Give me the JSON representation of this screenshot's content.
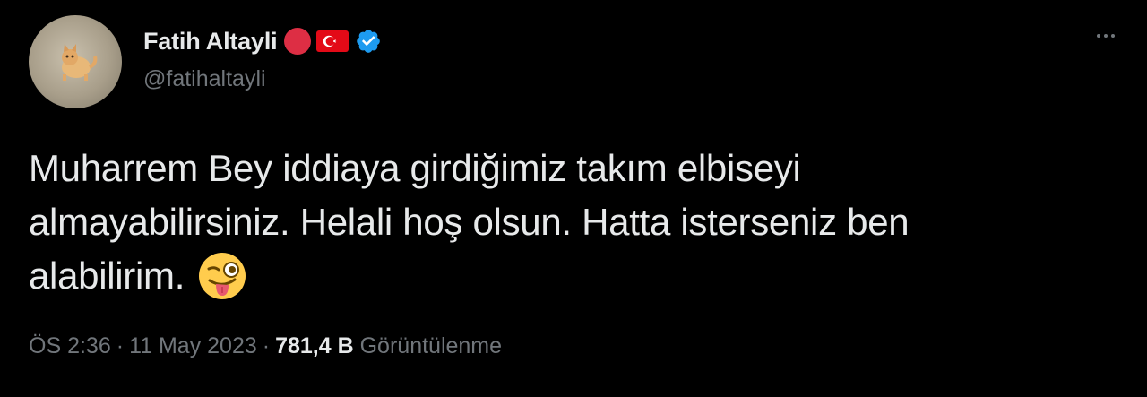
{
  "author": {
    "display_name": "Fatih Altayli",
    "handle": "@fatihaltayli",
    "avatar_icon": "cat-avatar",
    "badges": [
      "red-circle-emoji",
      "turkey-flag-emoji",
      "verified-badge-icon"
    ]
  },
  "tweet": {
    "lines": [
      "Muharrem Bey iddiaya girdiğimiz takım elbiseyi",
      "almayabilirsiniz. Helali hoş olsun. Hatta isterseniz ben",
      "alabilirim."
    ],
    "emoji": "winking-face-with-tongue-emoji"
  },
  "meta": {
    "time": "ÖS 2:36",
    "separator": "·",
    "date": "11 May 2023",
    "views_count": "781,4 B",
    "views_label": "Görüntülenme"
  },
  "colors": {
    "background": "#000000",
    "text_primary": "#e7e9ea",
    "text_secondary": "#71767b",
    "verified_blue": "#1d9bf0",
    "red": "#dd2e44",
    "flag_red": "#e30a17"
  }
}
